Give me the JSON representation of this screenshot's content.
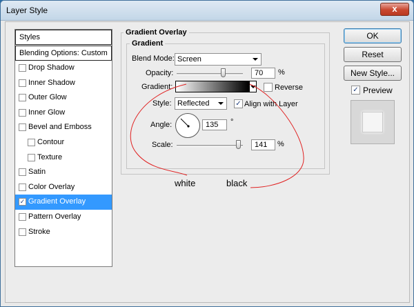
{
  "window": {
    "title": "Layer Style",
    "close_glyph": "x"
  },
  "styles_panel": {
    "header": "Styles",
    "blending": "Blending Options: Custom",
    "items": [
      {
        "label": "Drop Shadow",
        "checked": false,
        "sub": false
      },
      {
        "label": "Inner Shadow",
        "checked": false,
        "sub": false
      },
      {
        "label": "Outer Glow",
        "checked": false,
        "sub": false
      },
      {
        "label": "Inner Glow",
        "checked": false,
        "sub": false
      },
      {
        "label": "Bevel and Emboss",
        "checked": false,
        "sub": false
      },
      {
        "label": "Contour",
        "checked": false,
        "sub": true
      },
      {
        "label": "Texture",
        "checked": false,
        "sub": true
      },
      {
        "label": "Satin",
        "checked": false,
        "sub": false
      },
      {
        "label": "Color Overlay",
        "checked": false,
        "sub": false
      },
      {
        "label": "Gradient Overlay",
        "checked": true,
        "sub": false,
        "selected": true
      },
      {
        "label": "Pattern Overlay",
        "checked": false,
        "sub": false
      },
      {
        "label": "Stroke",
        "checked": false,
        "sub": false
      }
    ]
  },
  "gradient_overlay": {
    "section_title": "Gradient Overlay",
    "group_title": "Gradient",
    "blend_mode": {
      "label": "Blend Mode:",
      "value": "Screen"
    },
    "opacity": {
      "label": "Opacity:",
      "value": "70",
      "unit": "%",
      "level": 0.7
    },
    "gradient": {
      "label": "Gradient:",
      "reverse_label": "Reverse",
      "reverse_checked": false
    },
    "style": {
      "label": "Style:",
      "value": "Reflected",
      "align_label": "Align with Layer",
      "align_checked": true
    },
    "angle": {
      "label": "Angle:",
      "value": "135",
      "unit": "°"
    },
    "scale": {
      "label": "Scale:",
      "value": "141",
      "unit": "%",
      "level": 0.94
    }
  },
  "buttons": {
    "ok": "OK",
    "reset": "Reset",
    "new_style": "New Style...",
    "preview_label": "Preview",
    "preview_checked": true
  },
  "annotations": {
    "white": "white",
    "black": "black"
  },
  "colors": {
    "selection": "#3399ff",
    "annotation_red": "#e02020"
  }
}
